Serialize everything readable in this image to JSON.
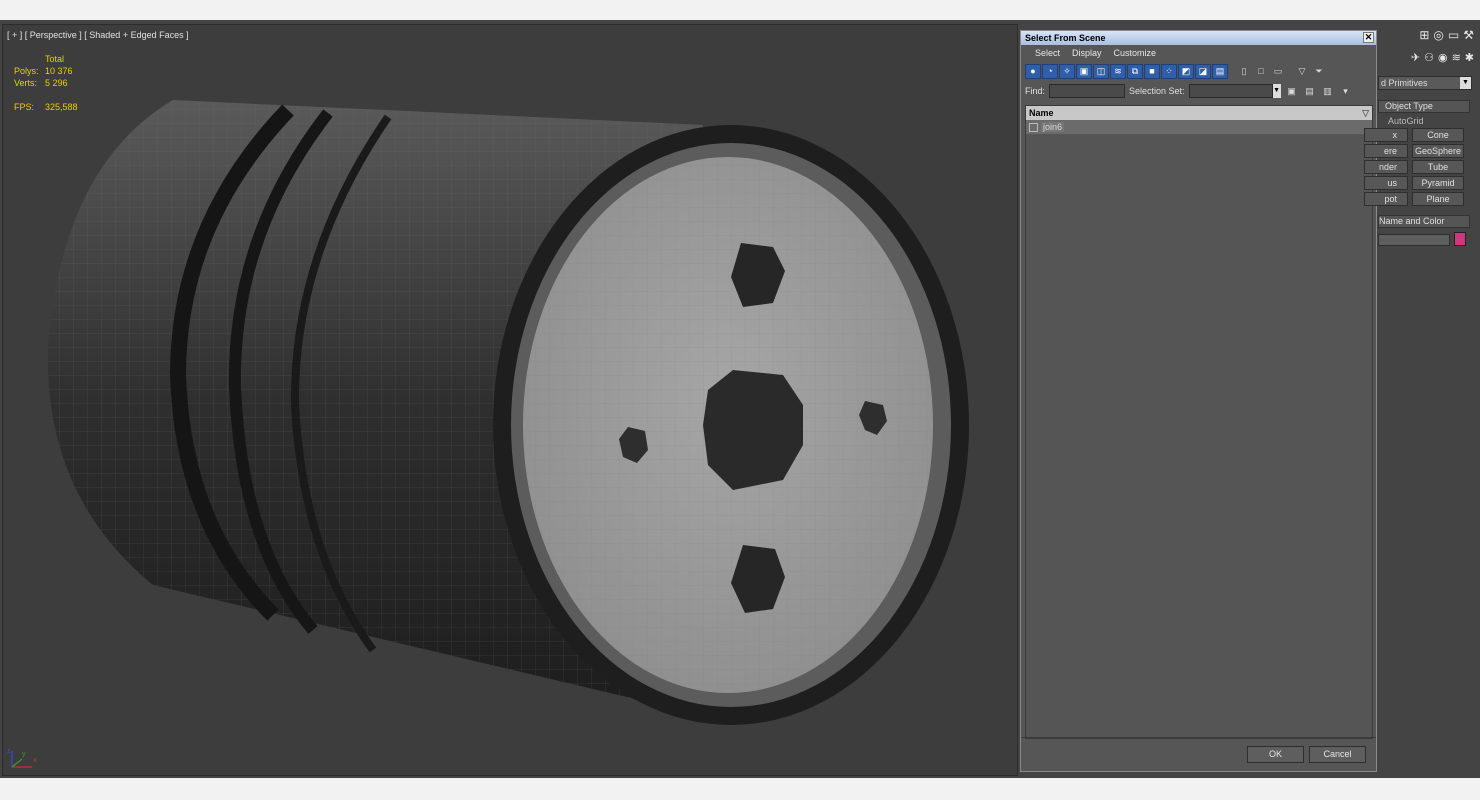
{
  "viewport": {
    "label": "[ + ] [ Perspective ] [ Shaded + Edged Faces ]",
    "stats": {
      "total_label": "Total",
      "polys_label": "Polys:",
      "polys_value": "10 376",
      "verts_label": "Verts:",
      "verts_value": "5 296",
      "fps_label": "FPS:",
      "fps_value": "325,588"
    },
    "axis": {
      "x": "x",
      "y": "y",
      "z": "z"
    }
  },
  "dialog": {
    "title": "Select From Scene",
    "close_glyph": "✕",
    "menu": [
      "Select",
      "Display",
      "Customize"
    ],
    "toolbar_icons": [
      "geometry-filter-icon",
      "shapes-filter-icon",
      "lights-filter-icon",
      "cameras-filter-icon",
      "helpers-filter-icon",
      "spacewarps-filter-icon",
      "groups-filter-icon",
      "xrefs-filter-icon",
      "bones-filter-icon",
      "containers-filter-icon",
      "frozen-filter-icon",
      "hidden-filter-icon",
      "all-filter-icon"
    ],
    "find_label": "Find:",
    "find_value": "",
    "selection_set_label": "Selection Set:",
    "selection_set_value": "",
    "list_header": "Name",
    "rows": [
      {
        "name": "join6"
      }
    ],
    "ok_label": "OK",
    "cancel_label": "Cancel"
  },
  "command_panel": {
    "category_value": "d Primitives",
    "object_type_label": "Object Type",
    "autogrid_label": "AutoGrid",
    "primitives_left": [
      "x",
      "ere",
      "nder",
      "us",
      "pot"
    ],
    "primitives_right": [
      "Cone",
      "GeoSphere",
      "Tube",
      "Pyramid",
      "Plane"
    ],
    "name_color_label": "Name and Color",
    "color": "#d6337f"
  },
  "colors": {
    "viewport_bg": "#3d3d3d",
    "stats_text": "#e6d200",
    "title_bar": "#b8cbe8",
    "selected_row": "#6b6b6b"
  }
}
